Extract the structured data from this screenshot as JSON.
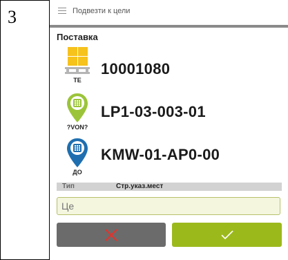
{
  "step": {
    "number": "3"
  },
  "header": {
    "title": "Подвезти к цели"
  },
  "section": {
    "title": "Поставка"
  },
  "rows": [
    {
      "icon": "pallet-icon",
      "caption": "ТЕ",
      "value": "10001080"
    },
    {
      "icon": "source-pin-icon",
      "caption": "?VON?",
      "value": "LP1-03-003-01"
    },
    {
      "icon": "destination-pin-icon",
      "caption": "ДО",
      "value": "KMW-01-AP0-00"
    }
  ],
  "type_table": {
    "label": "Тип",
    "value": "Стр.указ.мест"
  },
  "input": {
    "placeholder": "Це"
  },
  "buttons": {
    "cancel": "close-x-icon",
    "confirm": "checkmark-icon"
  },
  "colors": {
    "accent_green": "#9cb91c",
    "pallet_yellow": "#f6c21c",
    "pin_green": "#9cc43a",
    "pin_blue": "#1f6fb0",
    "cancel_red": "#e4322b"
  }
}
